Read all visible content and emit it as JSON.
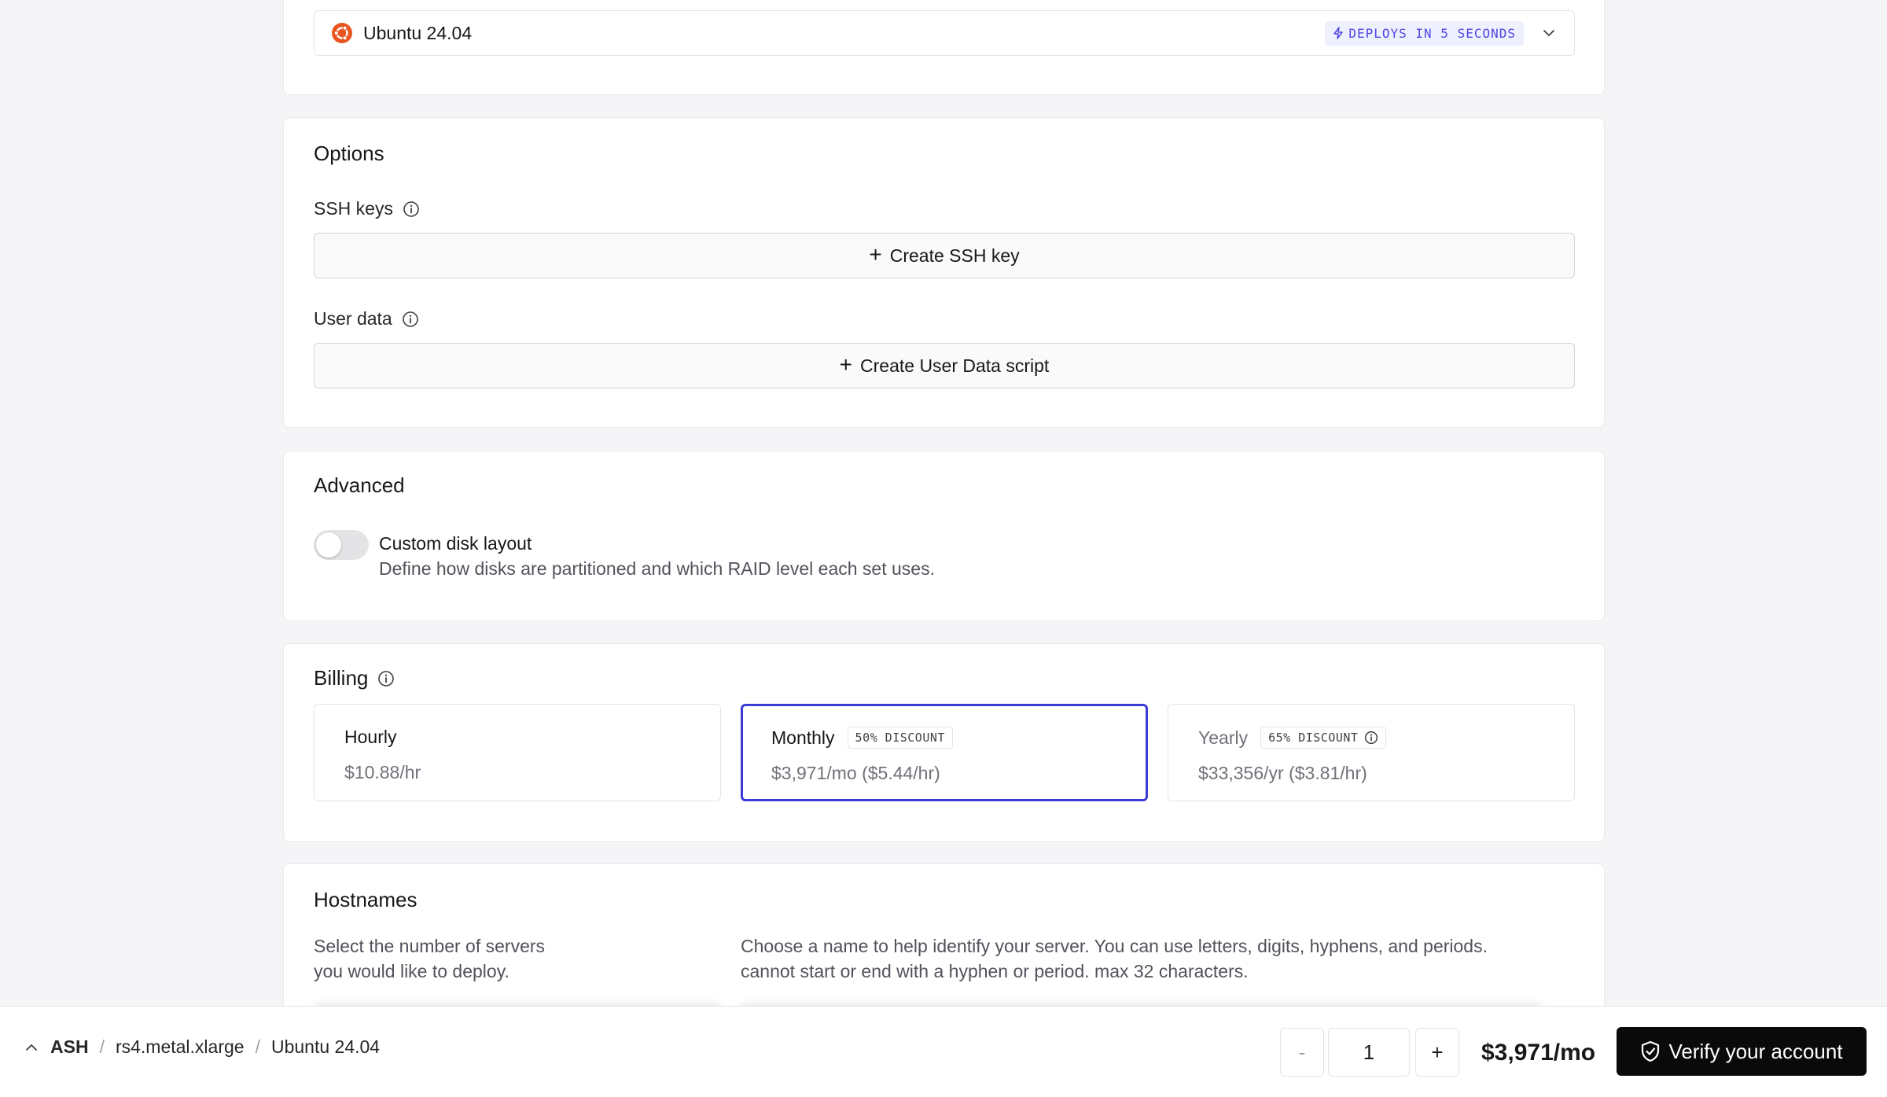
{
  "os_select": {
    "value": "Ubuntu 24.04",
    "badge": "DEPLOYS IN 5 SECONDS",
    "logo_icon": "ubuntu-logo-icon",
    "accent": "#e95420"
  },
  "options": {
    "title": "Options",
    "ssh_label": "SSH keys",
    "ssh_button": "Create SSH key",
    "user_data_label": "User data",
    "user_data_button": "Create User Data script"
  },
  "advanced": {
    "title": "Advanced",
    "toggle_title": "Custom disk layout",
    "toggle_desc": "Define how disks are partitioned and which RAID level each set uses.",
    "toggle_on": false
  },
  "billing": {
    "title": "Billing",
    "options": [
      {
        "name": "Hourly",
        "price": "$10.88/hr",
        "badge": ""
      },
      {
        "name": "Monthly",
        "price": "$3,971/mo ($5.44/hr)",
        "badge": "50% DISCOUNT",
        "selected": true
      },
      {
        "name": "Yearly",
        "price": "$33,356/yr ($3.81/hr)",
        "badge": "65% DISCOUNT"
      }
    ],
    "selected_color": "#3b3ad6"
  },
  "hostnames": {
    "title": "Hostnames",
    "count_desc_1": "Select the number of servers",
    "count_desc_2": "you would like to deploy.",
    "name_desc_1": "Choose a name to help identify your server. You can use letters, digits, hyphens, and periods.",
    "name_desc_2": "cannot start or end with a hyphen or period. max 32 characters."
  },
  "bottom_bar": {
    "crumbs": [
      "ASH",
      "rs4.metal.xlarge",
      "Ubuntu 24.04"
    ],
    "minus": "-",
    "quantity": "1",
    "plus": "+",
    "total": "$3,971/mo",
    "verify": "Verify your account"
  }
}
